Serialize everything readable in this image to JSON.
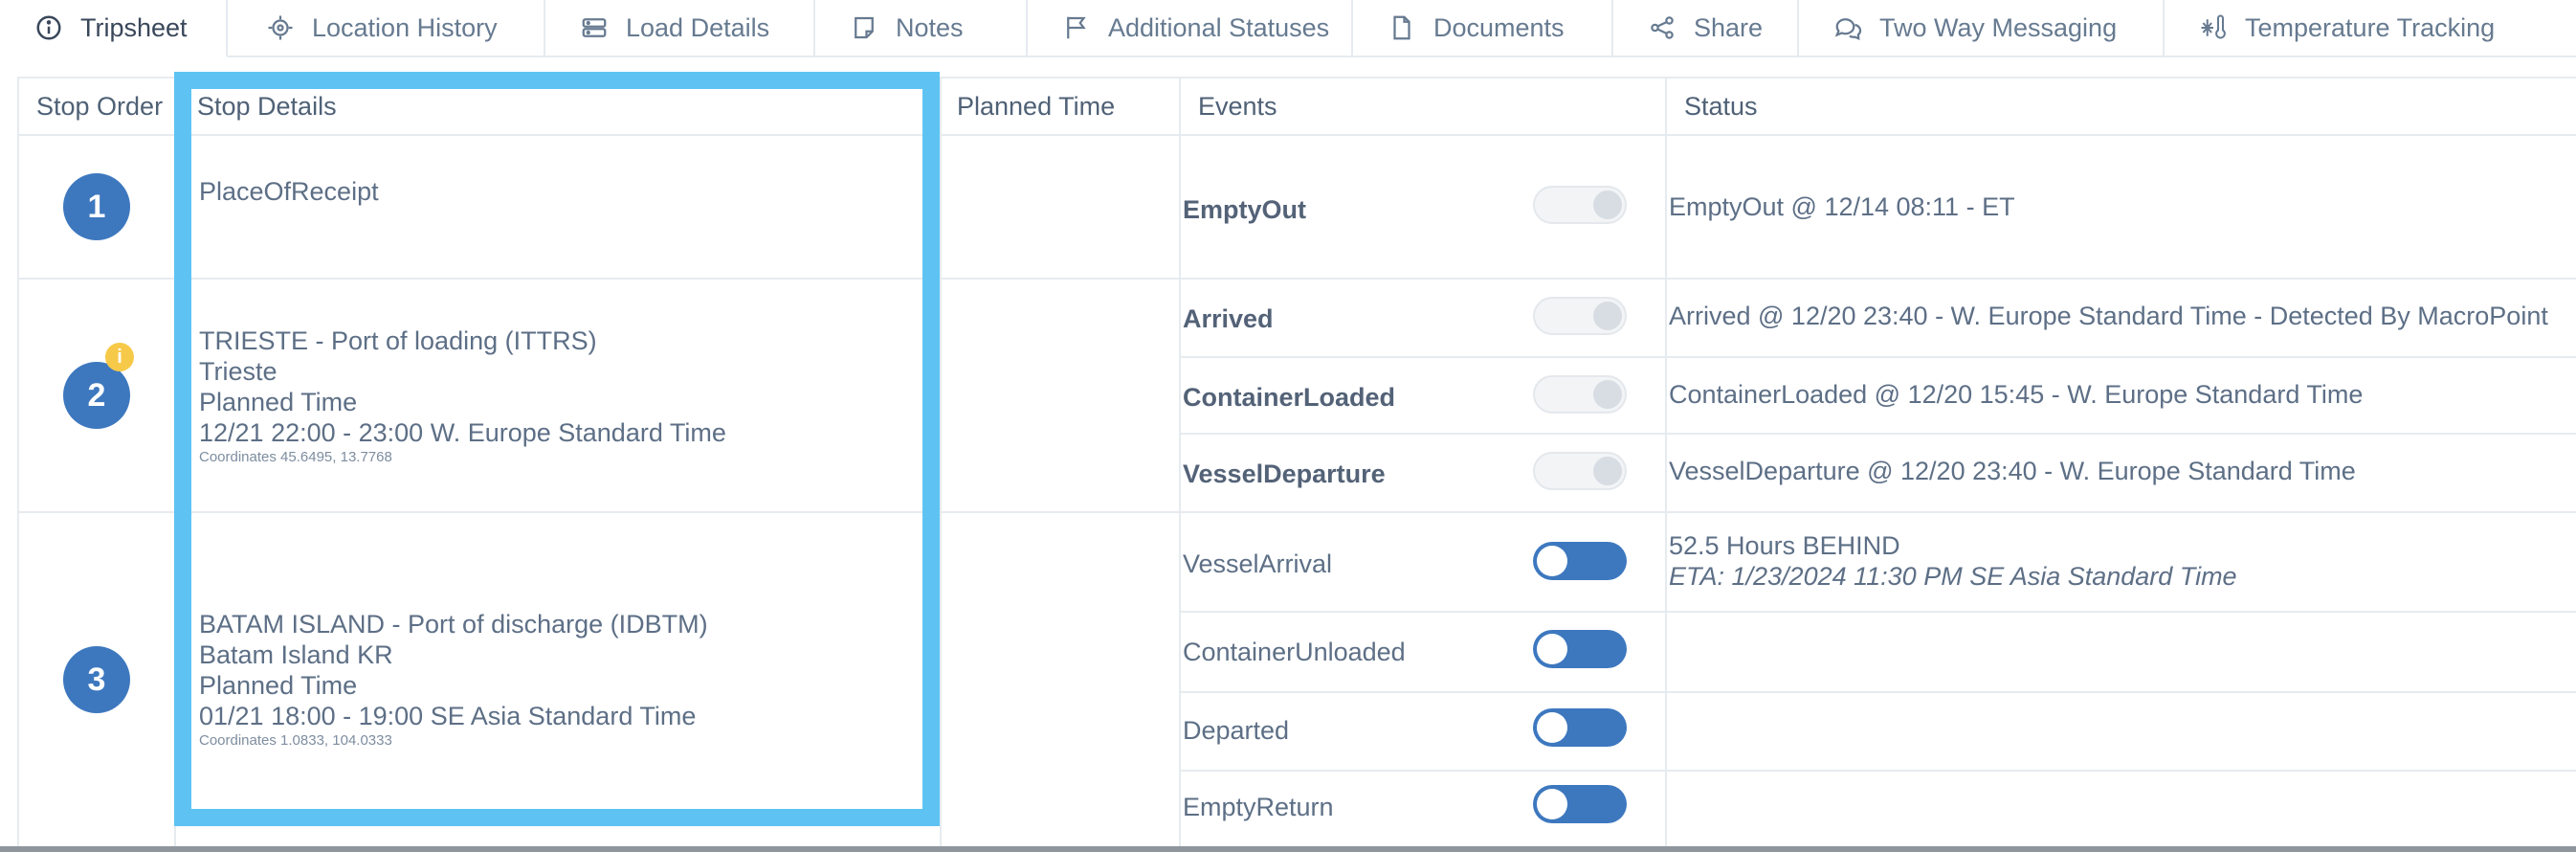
{
  "tabs": [
    {
      "label": "Tripsheet",
      "icon": "info-icon",
      "active": true
    },
    {
      "label": "Location History",
      "icon": "location-target-icon"
    },
    {
      "label": "Load Details",
      "icon": "server-icon"
    },
    {
      "label": "Notes",
      "icon": "note-icon"
    },
    {
      "label": "Additional Statuses",
      "icon": "flag-icon"
    },
    {
      "label": "Documents",
      "icon": "document-icon"
    },
    {
      "label": "Share",
      "icon": "share-icon"
    },
    {
      "label": "Two Way Messaging",
      "icon": "chat-icon"
    },
    {
      "label": "Temperature Tracking",
      "icon": "snowflake-thermometer-icon"
    }
  ],
  "table": {
    "headers": {
      "stop_order": "Stop Order",
      "stop_details": "Stop Details",
      "planned_time": "Planned Time",
      "events": "Events",
      "status": "Status"
    },
    "stops": [
      {
        "number": "1",
        "details": {
          "line1": "PlaceOfReceipt"
        },
        "events": [
          {
            "name": "EmptyOut",
            "toggle": "off",
            "status": "EmptyOut @ 12/14 08:11 - ET"
          }
        ]
      },
      {
        "number": "2",
        "badge": "i",
        "details": {
          "line1": "TRIESTE - Port of loading (ITTRS)",
          "line2": "Trieste",
          "line3": "Planned Time",
          "line4": "12/21 22:00 - 23:00 W. Europe Standard Time",
          "coords": "Coordinates  45.6495, 13.7768"
        },
        "events": [
          {
            "name": "Arrived",
            "toggle": "off",
            "status": "Arrived @ 12/20 23:40 - W. Europe Standard Time - Detected By MacroPoint"
          },
          {
            "name": "ContainerLoaded",
            "toggle": "off",
            "status": "ContainerLoaded @ 12/20 15:45 - W. Europe Standard Time"
          },
          {
            "name": "VesselDeparture",
            "toggle": "off",
            "status": "VesselDeparture @ 12/20 23:40 - W. Europe Standard Time"
          }
        ]
      },
      {
        "number": "3",
        "details": {
          "line1": "BATAM ISLAND - Port of discharge (IDBTM)",
          "line2": "Batam Island KR",
          "line3": "Planned Time",
          "line4": "01/21 18:00 - 19:00 SE Asia Standard Time",
          "coords": "Coordinates  1.0833, 104.0333"
        },
        "events": [
          {
            "name": "VesselArrival",
            "toggle": "on",
            "status": "52.5 Hours BEHIND",
            "eta": "ETA: 1/23/2024 11:30 PM SE Asia Standard Time"
          },
          {
            "name": "ContainerUnloaded",
            "toggle": "on",
            "status": ""
          },
          {
            "name": "Departed",
            "toggle": "on",
            "status": ""
          },
          {
            "name": "EmptyReturn",
            "toggle": "on",
            "status": ""
          }
        ]
      }
    ]
  }
}
